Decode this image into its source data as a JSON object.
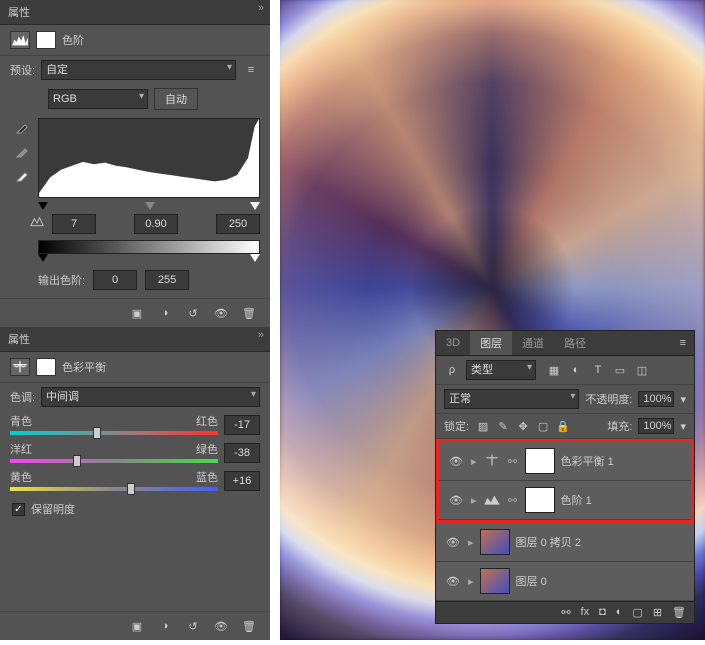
{
  "props_panel1": {
    "title": "属性",
    "icon_label": "色阶"
  },
  "levels": {
    "preset_label": "预设:",
    "preset_value": "自定",
    "channel": "RGB",
    "auto_btn": "自动",
    "black": "7",
    "gamma": "0.90",
    "white": "250",
    "output_label": "输出色阶:",
    "out_black": "0",
    "out_white": "255"
  },
  "props_panel2": {
    "title": "属性",
    "icon_label": "色彩平衡"
  },
  "color_balance": {
    "tone_label": "色调:",
    "tone_value": "中间调",
    "sliders": [
      {
        "left": "青色",
        "right": "红色",
        "value": "-17",
        "c1": "#00d0d0",
        "c2": "#ff3030",
        "pos": 42
      },
      {
        "left": "洋红",
        "right": "绿色",
        "value": "-38",
        "c1": "#ff40ff",
        "c2": "#40e040",
        "pos": 32
      },
      {
        "left": "黄色",
        "right": "蓝色",
        "value": "+16",
        "c1": "#f0e040",
        "c2": "#4060ff",
        "pos": 58
      }
    ],
    "preserve_lum": "保留明度",
    "checked": true
  },
  "layers": {
    "tabs": [
      "3D",
      "图层",
      "通道",
      "路径"
    ],
    "active_tab": 1,
    "type_label": "类型",
    "blend": "正常",
    "opacity_label": "不透明度:",
    "opacity": "100%",
    "lock_label": "锁定:",
    "fill_label": "填充:",
    "fill": "100%",
    "items": [
      {
        "name": "色彩平衡 1",
        "kind": "adj-balance",
        "hl": true
      },
      {
        "name": "色阶 1",
        "kind": "adj-levels",
        "hl": true
      },
      {
        "name": "图层 0 拷贝 2",
        "kind": "img"
      },
      {
        "name": "图层 0",
        "kind": "img"
      }
    ]
  }
}
